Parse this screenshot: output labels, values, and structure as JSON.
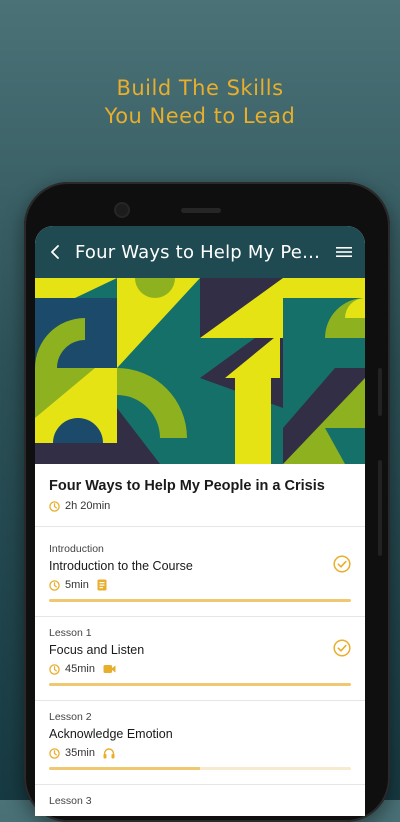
{
  "headline": {
    "line1": "Build The Skills",
    "line2": "You Need to Lead"
  },
  "appbar": {
    "title": "Four Ways to Help My People in a Crisis"
  },
  "course": {
    "title": "Four Ways to Help My People in a Crisis",
    "duration": "2h 20min"
  },
  "lessons": [
    {
      "label": "Introduction",
      "name": "Introduction to the Course",
      "duration": "5min",
      "type_icon": "document-icon",
      "completed": true,
      "progress": 1.0
    },
    {
      "label": "Lesson 1",
      "name": "Focus and Listen",
      "duration": "45min",
      "type_icon": "video-icon",
      "completed": true,
      "progress": 1.0
    },
    {
      "label": "Lesson 2",
      "name": "Acknowledge Emotion",
      "duration": "35min",
      "type_icon": "headphones-icon",
      "completed": false,
      "progress": 0.5
    },
    {
      "label": "Lesson 3"
    }
  ],
  "colors": {
    "accent": "#e8ae2c",
    "appbar": "#1f4a52",
    "progress_fill": "#f0c872",
    "progress_track": "#f7ead0"
  }
}
